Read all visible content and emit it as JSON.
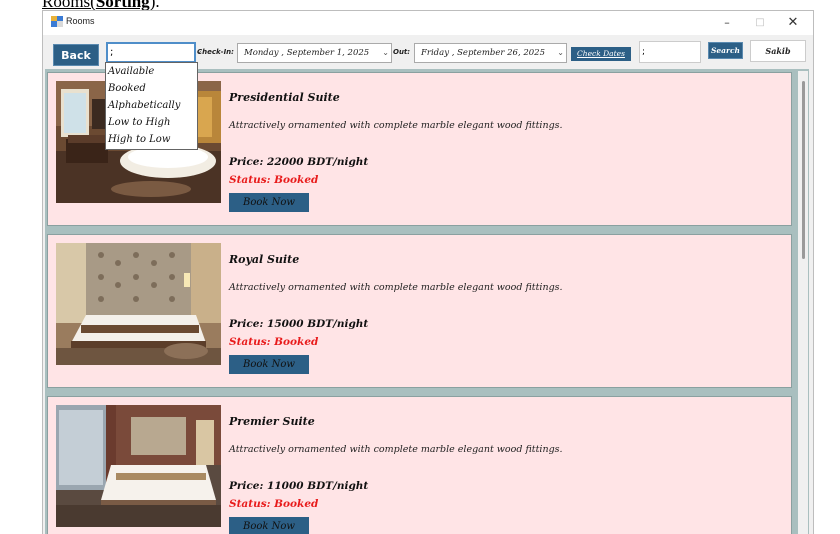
{
  "doc_heading": {
    "part1": "Rooms(",
    "part2": "Sorting",
    "part3": ")."
  },
  "window": {
    "title": "Rooms",
    "minimize": "–",
    "maximize": "□",
    "close": "✕"
  },
  "toolbar": {
    "back_label": "Back",
    "sort_value": ";",
    "checkin_label": "Check-In:",
    "checkin_value": "Monday   , September   1, 2025",
    "checkout_label": "Out:",
    "checkout_value": "Friday   , September 26, 2025",
    "check_dates_label": "Check Dates",
    "search_value": ";",
    "search_label": "Search",
    "user_label": "Sakib"
  },
  "sort_dropdown": {
    "options": [
      "Available",
      "Booked",
      "Alphabetically",
      "Low to High",
      "High to Low"
    ]
  },
  "rooms": [
    {
      "name": "Presidential Suite",
      "description": "Attractively ornamented with complete marble  elegant wood fittings.",
      "price": "Price: 22000 BDT/night",
      "status": "Status: Booked",
      "book_label": "Book Now"
    },
    {
      "name": "Royal Suite",
      "description": "Attractively ornamented with complete marble  elegant wood fittings.",
      "price": "Price: 15000 BDT/night",
      "status": "Status: Booked",
      "book_label": "Book Now"
    },
    {
      "name": "Premier Suite",
      "description": "Attractively ornamented with complete marble  elegant wood fittings.",
      "price": "Price: 11000 BDT/night",
      "status": "Status: Booked",
      "book_label": "Book Now"
    }
  ],
  "colors": {
    "accent": "#2c5f86",
    "card_bg": "#ffe4e6",
    "panel_bg": "#a9bfbf",
    "status_booked": "#e81b1b"
  }
}
